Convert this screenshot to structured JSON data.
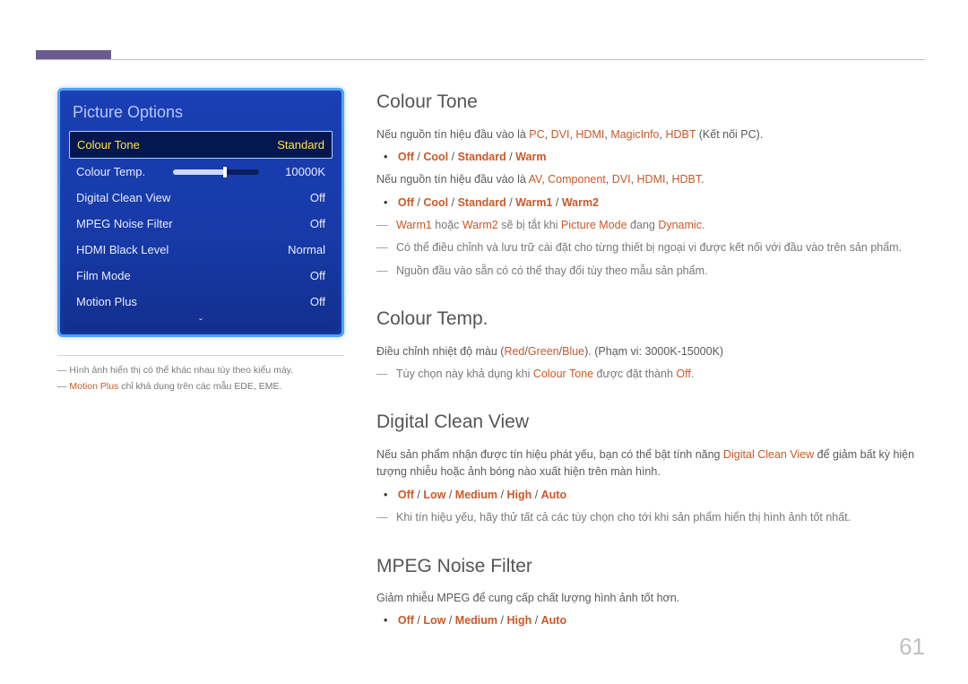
{
  "page_number": "61",
  "osd": {
    "title": "Picture Options",
    "rows": [
      {
        "label": "Colour Tone",
        "value": "Standard",
        "selected": true
      },
      {
        "label": "Colour Temp.",
        "value": "10000K",
        "slider": true
      },
      {
        "label": "Digital Clean View",
        "value": "Off"
      },
      {
        "label": "MPEG Noise Filter",
        "value": "Off"
      },
      {
        "label": "HDMI Black Level",
        "value": "Normal"
      },
      {
        "label": "Film Mode",
        "value": "Off"
      },
      {
        "label": "Motion Plus",
        "value": "Off"
      }
    ]
  },
  "footnotes": {
    "f1_pre": "― Hình ảnh hiển thị có thể khác nhau tùy theo kiểu máy.",
    "f2_pre": "― ",
    "f2_em": "Motion Plus",
    "f2_post": " chỉ khả dụng trên các mẫu EDE, EME."
  },
  "sect_colour_tone": {
    "heading": "Colour Tone",
    "p1_pre": "Nếu nguồn tín hiệu đầu vào là ",
    "p1_src": "PC",
    "p1_s2": "DVI",
    "p1_s3": "HDMI",
    "p1_s4": "MagicInfo",
    "p1_s5": "HDBT",
    "p1_post": " (Kết nối PC).",
    "opts1_off": "Off",
    "opts1_cool": "Cool",
    "opts1_std": "Standard",
    "opts1_warm": "Warm",
    "p2_pre": "Nếu nguồn tín hiệu đầu vào là ",
    "p2_s1": "AV",
    "p2_s2": "Component",
    "p2_s3": "DVI",
    "p2_s4": "HDMI",
    "p2_s5": "HDBT",
    "p2_post": ".",
    "opts2_off": "Off",
    "opts2_cool": "Cool",
    "opts2_std": "Standard",
    "opts2_w1": "Warm1",
    "opts2_w2": "Warm2",
    "d1_w1": "Warm1",
    "d1_or": " hoặc ",
    "d1_w2": "Warm2",
    "d1_mid": " sẽ bị tắt khi ",
    "d1_pm": "Picture Mode",
    "d1_mid2": " đang ",
    "d1_dyn": "Dynamic",
    "d1_end": ".",
    "d2": "Có thể điều chỉnh và lưu trữ cài đặt cho từng thiết bị ngoại vi được kết nối với đầu vào trên sản phẩm.",
    "d3": "Nguồn đầu vào sẵn có có thể thay đổi tùy theo mẫu sản phẩm."
  },
  "sect_colour_temp": {
    "heading": "Colour Temp.",
    "p1_pre": "Điều chỉnh nhiệt độ màu (",
    "p1_r": "Red",
    "p1_sep": "/",
    "p1_g": "Green",
    "p1_b": "Blue",
    "p1_post": "). (Phạm vi: 3000K-15000K)",
    "d1_pre": "Tùy chọn này khả dụng khi ",
    "d1_ct": "Colour Tone",
    "d1_mid": " được đặt thành ",
    "d1_off": "Off",
    "d1_end": "."
  },
  "sect_dcv": {
    "heading": "Digital Clean View",
    "p1_pre": "Nếu sản phẩm nhận được tín hiệu phát yếu, bạn có thể bật tính năng ",
    "p1_em": "Digital Clean View",
    "p1_post": " để giảm bất kỳ hiện tượng nhiễu hoặc ảnh bóng nào xuất hiện trên màn hình.",
    "opts_off": "Off",
    "opts_low": "Low",
    "opts_med": "Medium",
    "opts_high": "High",
    "opts_auto": "Auto",
    "d1": "Khi tín hiệu yếu, hãy thử tất cả các tùy chọn cho tới khi sản phẩm hiển thị hình ảnh tốt nhất."
  },
  "sect_mpeg": {
    "heading": "MPEG Noise Filter",
    "p1": "Giảm nhiễu MPEG để cung cấp chất lượng hình ảnh tốt hơn.",
    "opts_off": "Off",
    "opts_low": "Low",
    "opts_med": "Medium",
    "opts_high": "High",
    "opts_auto": "Auto"
  }
}
